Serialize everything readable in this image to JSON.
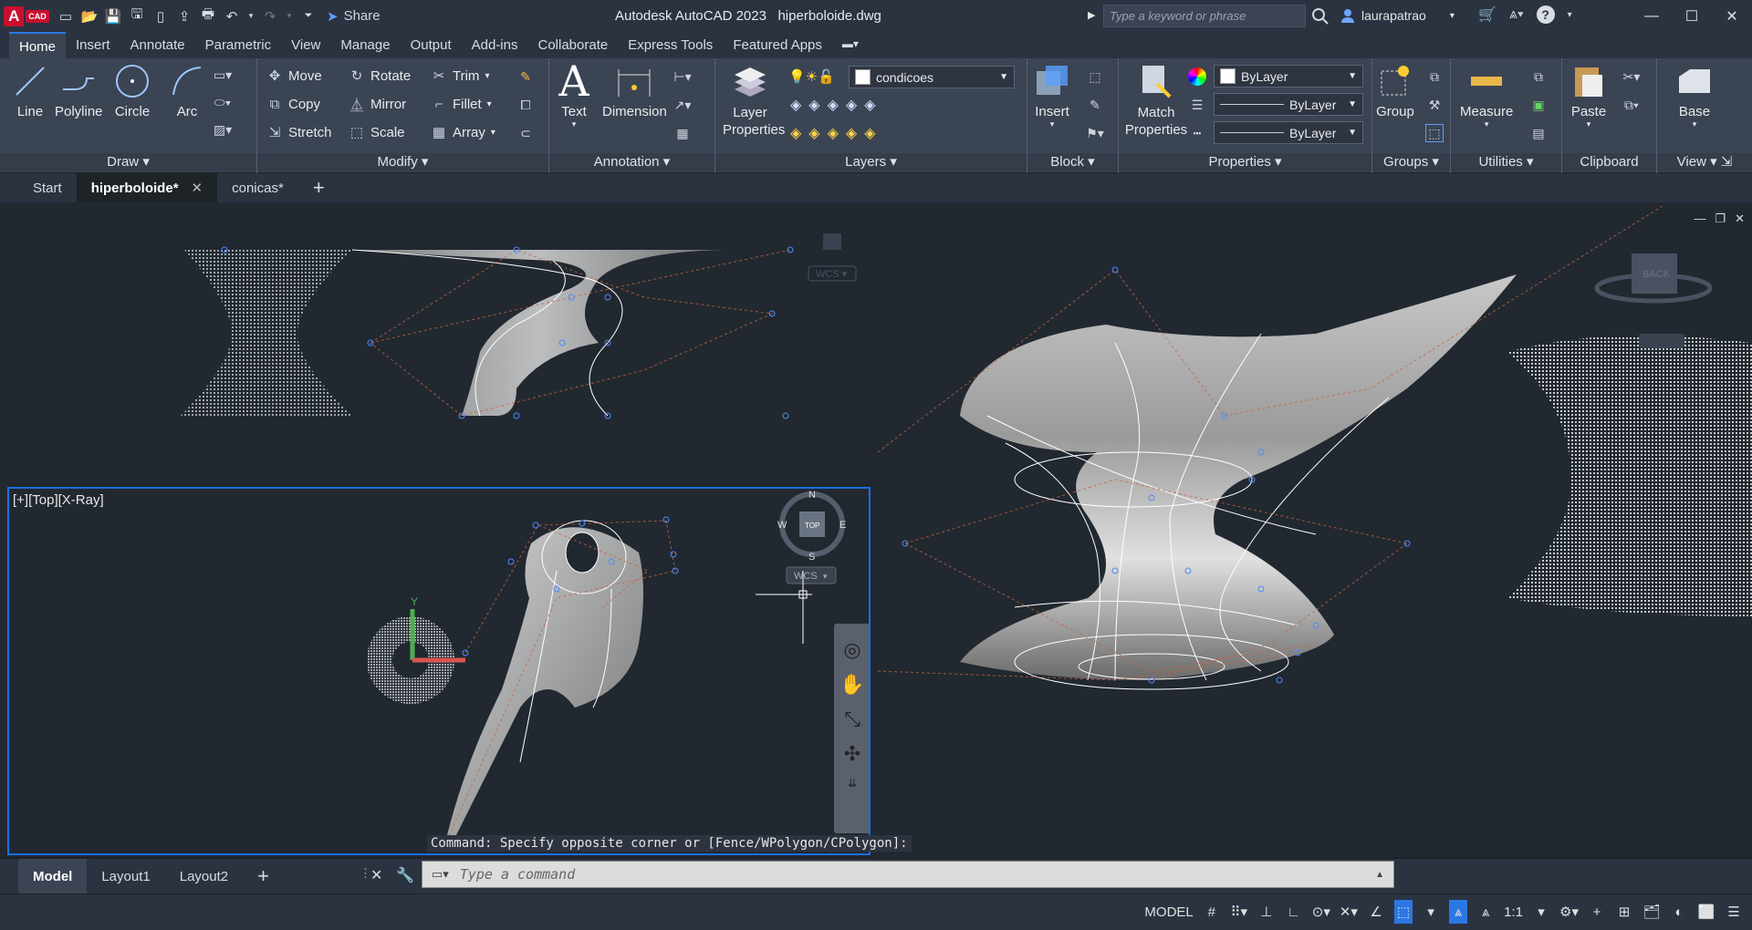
{
  "titlebar": {
    "logo": "A",
    "logo_sub": "CAD",
    "share": "Share",
    "app_name": "Autodesk AutoCAD 2023",
    "file_name": "hiperboloide.dwg",
    "search_placeholder": "Type a keyword or phrase",
    "user": "laurapatrao"
  },
  "ribbon_tabs": [
    "Home",
    "Insert",
    "Annotate",
    "Parametric",
    "View",
    "Manage",
    "Output",
    "Add-ins",
    "Collaborate",
    "Express Tools",
    "Featured Apps"
  ],
  "ribbon": {
    "draw": {
      "title": "Draw",
      "line": "Line",
      "polyline": "Polyline",
      "circle": "Circle",
      "arc": "Arc"
    },
    "modify": {
      "title": "Modify",
      "move": "Move",
      "rotate": "Rotate",
      "trim": "Trim",
      "copy": "Copy",
      "mirror": "Mirror",
      "fillet": "Fillet",
      "stretch": "Stretch",
      "scale": "Scale",
      "array": "Array"
    },
    "annotation": {
      "title": "Annotation",
      "text": "Text",
      "dimension": "Dimension"
    },
    "layers": {
      "title": "Layers",
      "layer_properties": "Layer Properties",
      "current_layer": "condicoes"
    },
    "block": {
      "title": "Block",
      "insert": "Insert"
    },
    "properties": {
      "title": "Properties",
      "match": "Match Properties",
      "color": "ByLayer",
      "linetype": "ByLayer",
      "lineweight": "ByLayer"
    },
    "groups": {
      "title": "Groups",
      "group": "Group"
    },
    "utilities": {
      "title": "Utilities",
      "measure": "Measure"
    },
    "clipboard": {
      "title": "Clipboard",
      "paste": "Paste"
    },
    "view": {
      "title": "View",
      "base": "Base"
    }
  },
  "doc_tabs": [
    "Start",
    "hiperboloide*",
    "conicas*"
  ],
  "viewports": {
    "bottom_left_label": "[+][Top][X-Ray]",
    "wcs": "WCS",
    "compass": {
      "n": "N",
      "s": "S",
      "e": "E",
      "w": "W",
      "top": "TOP"
    },
    "viewcube_face": "BACK",
    "ucs_y": "Y"
  },
  "command_history": "Command: Specify opposite corner or [Fence/WPolygon/CPolygon]:",
  "command_placeholder": "Type a command",
  "layout_tabs": [
    "Model",
    "Layout1",
    "Layout2"
  ],
  "status": {
    "model": "MODEL",
    "scale": "1:1"
  }
}
